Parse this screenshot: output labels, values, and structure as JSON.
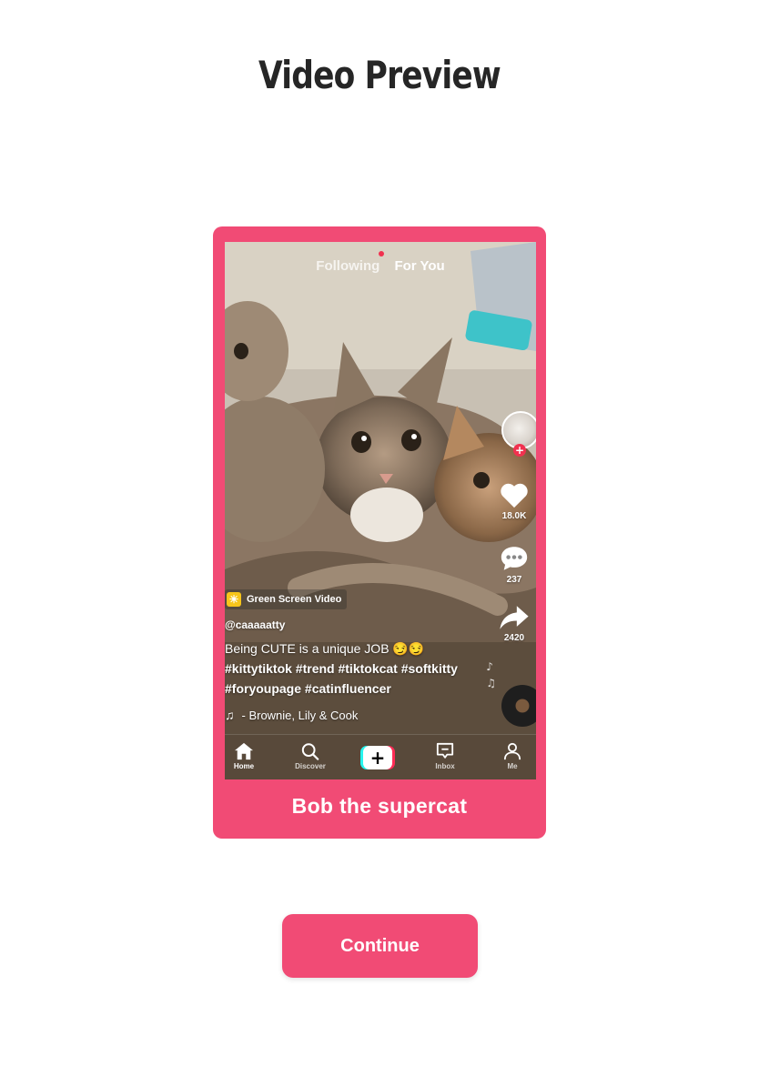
{
  "page": {
    "title": "Video Preview",
    "accent_color": "#f14b75"
  },
  "preview": {
    "caption": "Bob the supercat",
    "top_tabs": {
      "following": "Following",
      "for_you": "For You"
    },
    "effect_label": "Green Screen Video",
    "username": "@caaaaatty",
    "description_lines": [
      "Being CUTE is a unique JOB 😏😏",
      "#kittytiktok #trend #tiktokcat #softkitty",
      "#foryoupage #catinfluencer"
    ],
    "sound": "- Brownie, Lily & Cook",
    "stats": {
      "likes": "18.0K",
      "comments": "237",
      "shares": "2420"
    },
    "nav": [
      {
        "label": "Home",
        "icon": "home-icon",
        "active": true
      },
      {
        "label": "Discover",
        "icon": "search-icon",
        "active": false
      },
      {
        "label": "",
        "icon": "create-plus-icon",
        "active": false
      },
      {
        "label": "Inbox",
        "icon": "inbox-icon",
        "active": false
      },
      {
        "label": "Me",
        "icon": "profile-icon",
        "active": false
      }
    ]
  },
  "actions": {
    "continue_label": "Continue"
  }
}
